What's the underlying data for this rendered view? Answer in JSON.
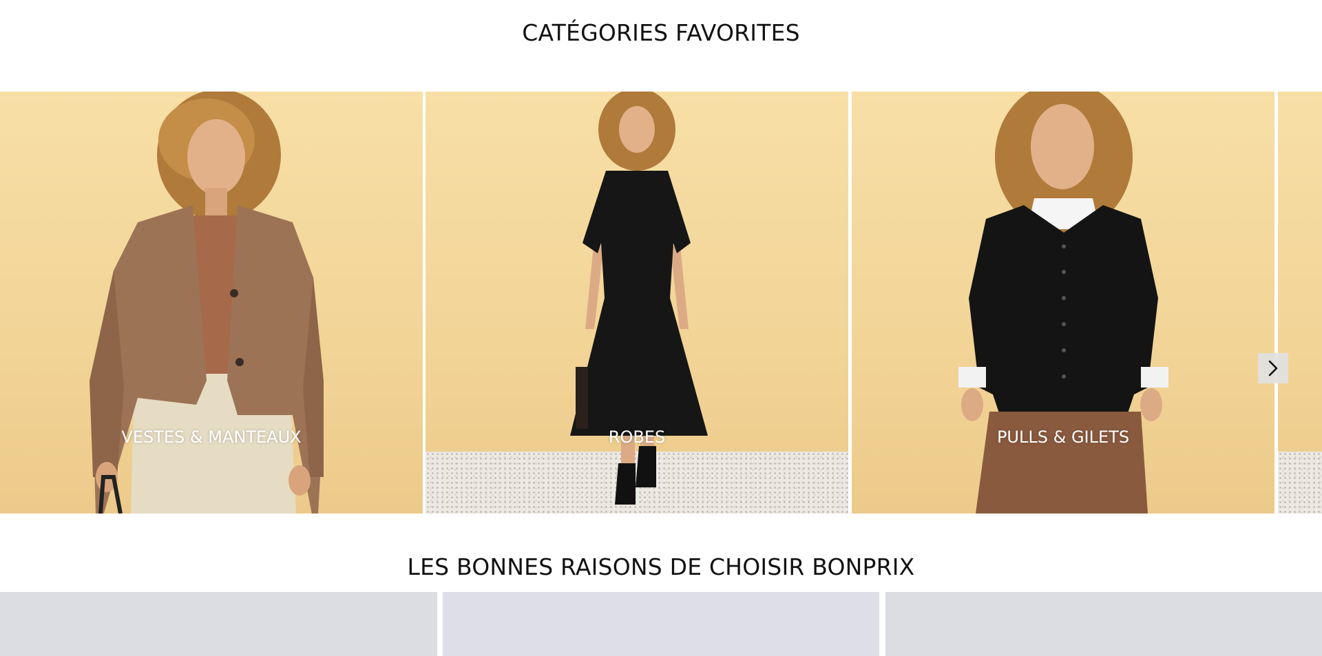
{
  "favorites": {
    "title": "CATÉGORIES FAVORITES",
    "categories": [
      {
        "label": "VESTES & MANTEAUX"
      },
      {
        "label": "ROBES"
      },
      {
        "label": "PULLS & GILETS"
      }
    ],
    "next_icon": "chevron-right-icon"
  },
  "reasons": {
    "title": "LES BONNES RAISONS DE CHOISIR BONPRIX"
  },
  "colors": {
    "wall": "#f4d89d",
    "reason_tile": "#dcdce3",
    "text_dark": "#111111"
  }
}
